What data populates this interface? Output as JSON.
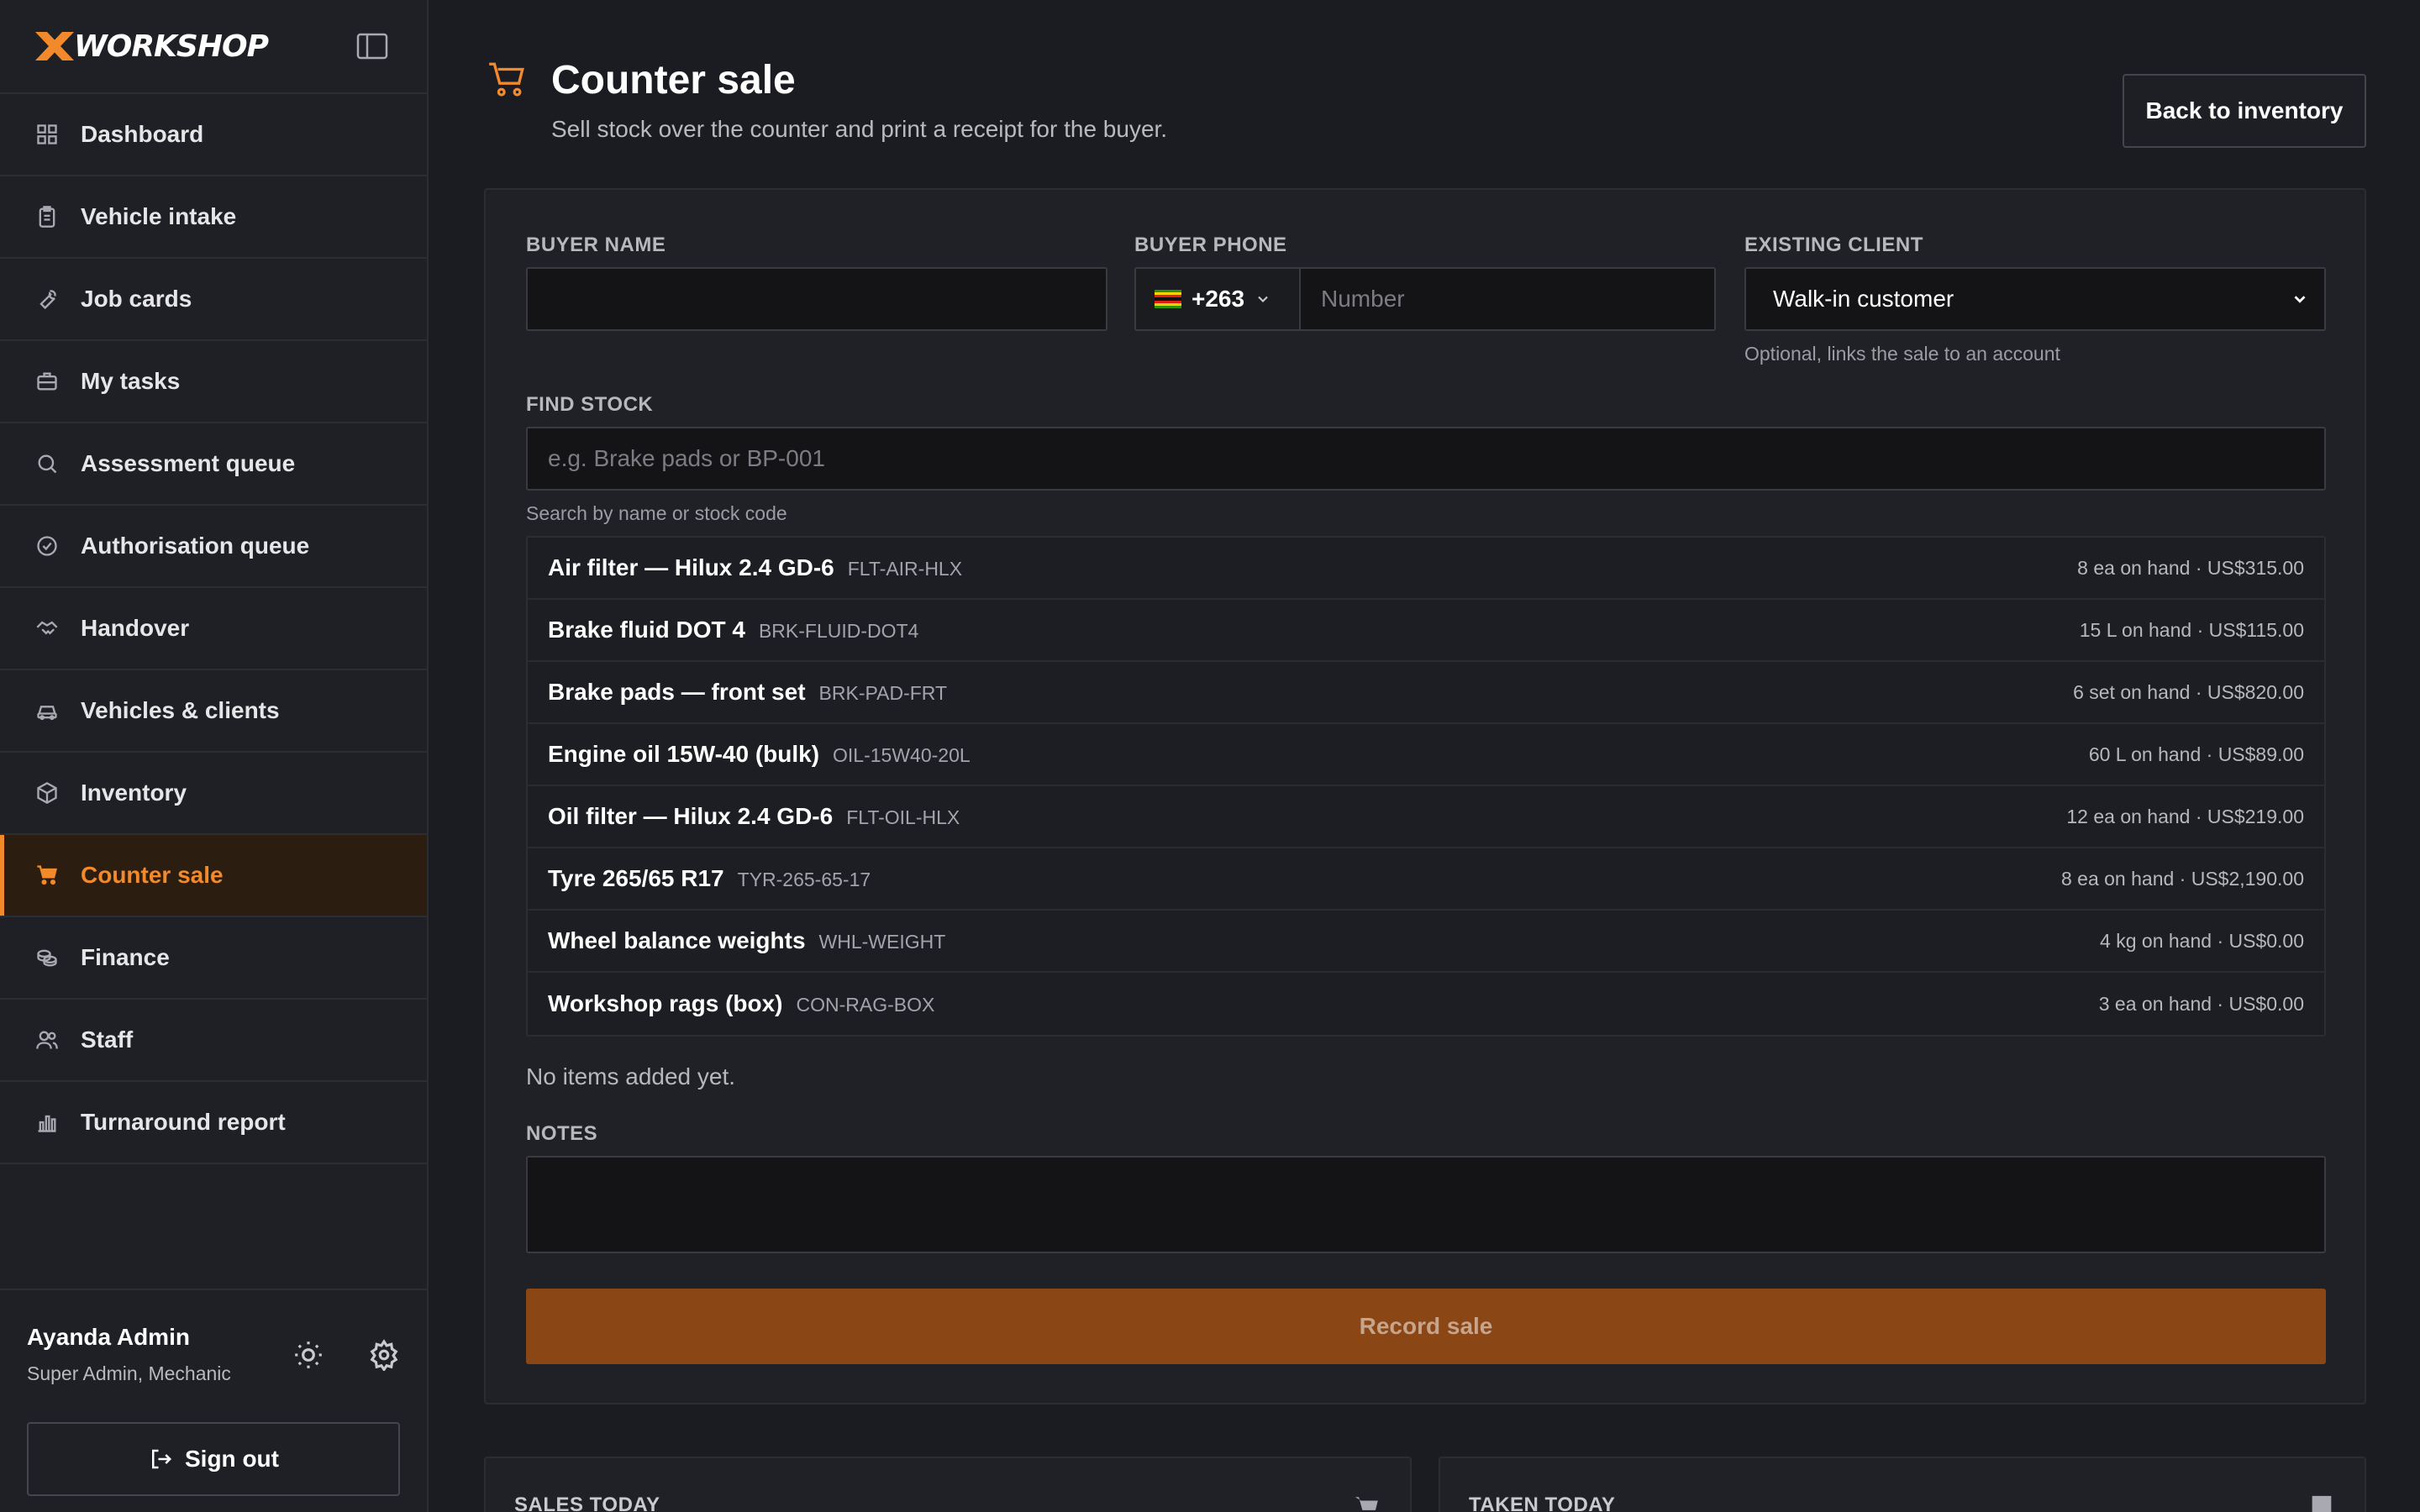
{
  "brand": {
    "name": "WORKSHOP",
    "accent": "#f28a2c"
  },
  "sidebar": {
    "items": [
      {
        "label": "Dashboard",
        "icon": "grid-icon"
      },
      {
        "label": "Vehicle intake",
        "icon": "clipboard-icon"
      },
      {
        "label": "Job cards",
        "icon": "wrench-icon"
      },
      {
        "label": "My tasks",
        "icon": "briefcase-icon"
      },
      {
        "label": "Assessment queue",
        "icon": "search-icon"
      },
      {
        "label": "Authorisation queue",
        "icon": "badge-check-icon"
      },
      {
        "label": "Handover",
        "icon": "handshake-icon"
      },
      {
        "label": "Vehicles & clients",
        "icon": "car-icon"
      },
      {
        "label": "Inventory",
        "icon": "box-icon"
      },
      {
        "label": "Counter sale",
        "icon": "cart-icon",
        "active": true
      },
      {
        "label": "Finance",
        "icon": "coins-icon"
      },
      {
        "label": "Staff",
        "icon": "users-icon"
      },
      {
        "label": "Turnaround report",
        "icon": "bar-chart-icon"
      }
    ],
    "user": {
      "name": "Ayanda Admin",
      "role": "Super Admin, Mechanic"
    },
    "sign_out": "Sign out"
  },
  "header": {
    "title": "Counter sale",
    "subtitle": "Sell stock over the counter and print a receipt for the buyer.",
    "back_label": "Back to inventory"
  },
  "form": {
    "buyer_name": {
      "label": "BUYER NAME",
      "value": ""
    },
    "buyer_phone": {
      "label": "BUYER PHONE",
      "code": "+263",
      "placeholder": "Number"
    },
    "existing_client": {
      "label": "EXISTING CLIENT",
      "value": "Walk-in customer",
      "hint": "Optional, links the sale to an account"
    },
    "find_stock": {
      "label": "FIND STOCK",
      "placeholder": "e.g. Brake pads or BP-001",
      "hint": "Search by name or stock code"
    },
    "stock": [
      {
        "name": "Air filter — Hilux 2.4 GD-6",
        "code": "FLT-AIR-HLX",
        "info": "8 ea on hand · US$315.00"
      },
      {
        "name": "Brake fluid DOT 4",
        "code": "BRK-FLUID-DOT4",
        "info": "15 L on hand · US$115.00"
      },
      {
        "name": "Brake pads — front set",
        "code": "BRK-PAD-FRT",
        "info": "6 set on hand · US$820.00"
      },
      {
        "name": "Engine oil 15W-40 (bulk)",
        "code": "OIL-15W40-20L",
        "info": "60 L on hand · US$89.00"
      },
      {
        "name": "Oil filter — Hilux 2.4 GD-6",
        "code": "FLT-OIL-HLX",
        "info": "12 ea on hand · US$219.00"
      },
      {
        "name": "Tyre 265/65 R17",
        "code": "TYR-265-65-17",
        "info": "8 ea on hand · US$2,190.00"
      },
      {
        "name": "Wheel balance weights",
        "code": "WHL-WEIGHT",
        "info": "4 kg on hand · US$0.00"
      },
      {
        "name": "Workshop rags (box)",
        "code": "CON-RAG-BOX",
        "info": "3 ea on hand · US$0.00"
      }
    ],
    "empty_message": "No items added yet.",
    "notes": {
      "label": "NOTES",
      "value": ""
    },
    "record_label": "Record sale"
  },
  "stats": {
    "sales_today": "SALES TODAY",
    "taken_today": "TAKEN TODAY"
  }
}
